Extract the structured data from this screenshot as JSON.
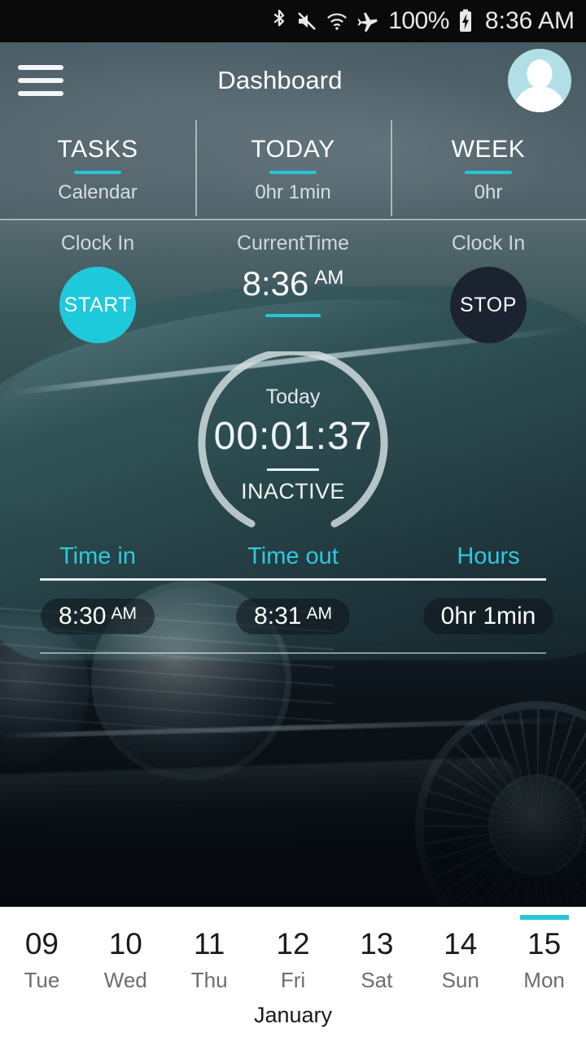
{
  "status_bar": {
    "icons": [
      "bluetooth-icon",
      "volume-mute-icon",
      "wifi-icon",
      "airplane-mode-icon"
    ],
    "battery_percent": "100%",
    "battery_state": "charging",
    "clock": "8:36 AM"
  },
  "app_bar": {
    "menu_icon": "hamburger-menu-icon",
    "title": "Dashboard",
    "avatar_icon": "user-avatar-icon"
  },
  "stats": [
    {
      "label": "TASKS",
      "value": "Calendar"
    },
    {
      "label": "TODAY",
      "value": "0hr 1min"
    },
    {
      "label": "WEEK",
      "value": "0hr"
    }
  ],
  "controls": {
    "start_caption": "Clock In",
    "start_label": "START",
    "current_time_caption": "CurrentTime",
    "current_time_value": "8:36",
    "current_time_meridiem": "AM",
    "stop_caption": "Clock In",
    "stop_label": "STOP"
  },
  "timer": {
    "top_label": "Today",
    "elapsed": "00:01:37",
    "status": "INACTIVE"
  },
  "time_table": {
    "headers": [
      "Time in",
      "Time out",
      "Hours"
    ],
    "rows": [
      {
        "time_in": "8:30",
        "time_in_meridiem": "AM",
        "time_out": "8:31",
        "time_out_meridiem": "AM",
        "hours": "0hr 1min",
        "hours_meridiem": ""
      }
    ]
  },
  "date_strip": {
    "days": [
      {
        "num": "09",
        "day": "Tue",
        "selected": false
      },
      {
        "num": "10",
        "day": "Wed",
        "selected": false
      },
      {
        "num": "11",
        "day": "Thu",
        "selected": false
      },
      {
        "num": "12",
        "day": "Fri",
        "selected": false
      },
      {
        "num": "13",
        "day": "Sat",
        "selected": false
      },
      {
        "num": "14",
        "day": "Sun",
        "selected": false
      },
      {
        "num": "15",
        "day": "Mon",
        "selected": true
      }
    ],
    "month": "January"
  },
  "colors": {
    "accent_cyan": "#26c6d8",
    "start_button": "#1fc9dc",
    "stop_button": "#1b2230",
    "avatar_bg": "#b2dfe6",
    "header_text": "#ffffff",
    "date_strip_bg": "#ffffff"
  }
}
